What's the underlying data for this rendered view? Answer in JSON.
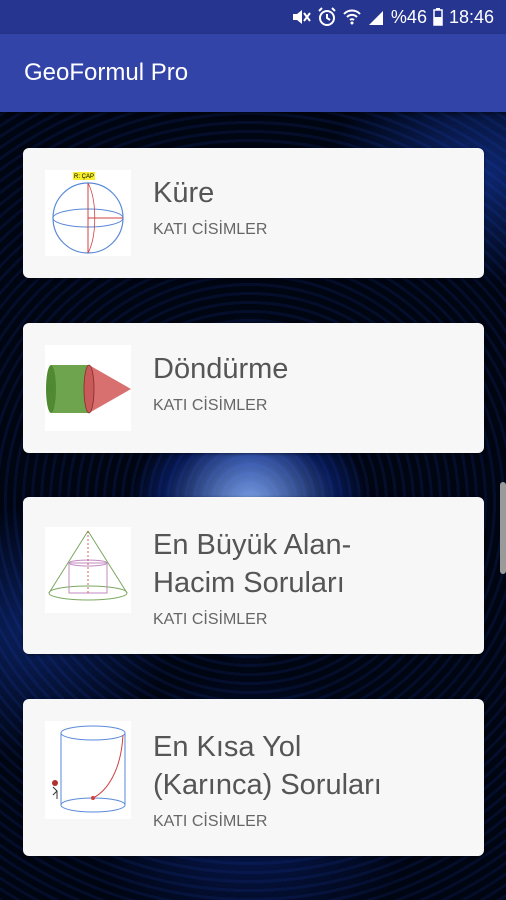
{
  "status_bar": {
    "battery_percent": "%46",
    "time": "18:46",
    "icons": [
      "mute-icon",
      "alarm-icon",
      "wifi-icon",
      "signal-icon",
      "battery-icon"
    ]
  },
  "app_bar": {
    "title": "GeoFormul Pro"
  },
  "cards": [
    {
      "title": "Küre",
      "subtitle": "KATI CİSİMLER",
      "thumbnail": "sphere-figure",
      "thumb_label": "R: ÇAP"
    },
    {
      "title": "Döndürme",
      "subtitle": "KATI CİSİMLER",
      "thumbnail": "cylinder-cone-figure"
    },
    {
      "title_line1": "En Büyük Alan-",
      "title_line2": "Hacim Soruları",
      "subtitle": "KATI CİSİMLER",
      "thumbnail": "cone-figure"
    },
    {
      "title_line1": "En Kısa Yol",
      "title_line2": "(Karınca) Soruları",
      "subtitle": "KATI CİSİMLER",
      "thumbnail": "cylinder-path-figure"
    }
  ],
  "colors": {
    "status_bar": "#26358f",
    "app_bar": "#3344a8",
    "card": "#f7f7f7"
  }
}
